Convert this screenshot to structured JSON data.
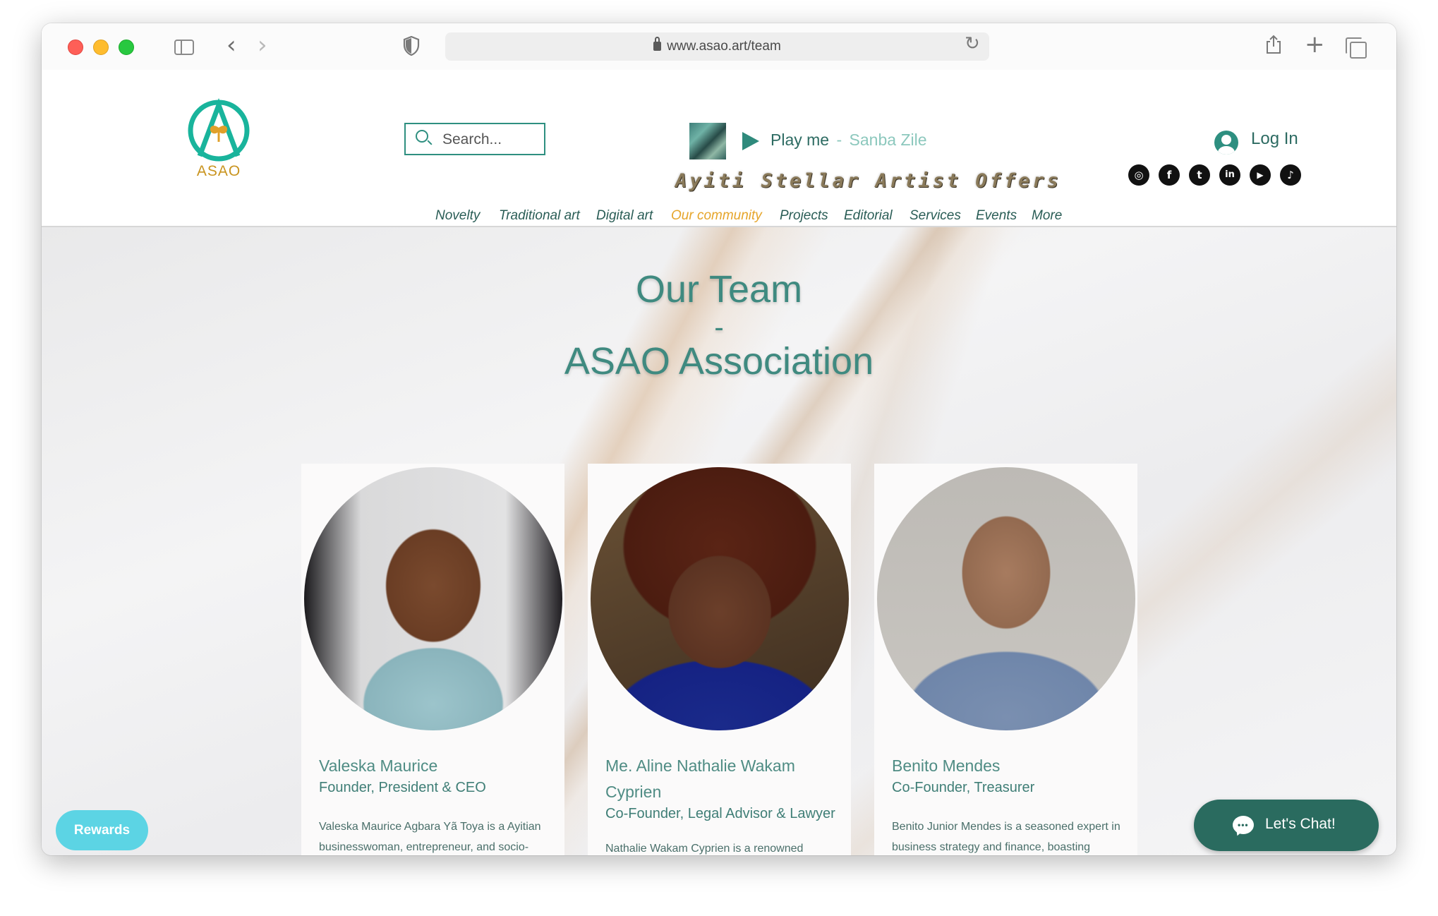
{
  "browser": {
    "url": "www.asao.art/team"
  },
  "header": {
    "logo_text": "ASAO",
    "search_placeholder": "Search...",
    "player": {
      "label": "Play me",
      "separator": "-",
      "song": "Sanba Zile"
    },
    "tagline": "Ayiti Stellar Artist Offers",
    "login_label": "Log In",
    "social_icons": [
      "instagram-icon",
      "facebook-icon",
      "twitter-icon",
      "linkedin-icon",
      "youtube-icon",
      "tiktok-icon"
    ]
  },
  "nav": {
    "items": [
      "Novelty",
      "Traditional art",
      "Digital art",
      "Our community",
      "Projects",
      "Editorial",
      "Services",
      "Events",
      "More"
    ],
    "active": "Our community"
  },
  "page": {
    "title_line1": "Our Team",
    "title_line2": "-",
    "title_line3": "ASAO Association"
  },
  "team": [
    {
      "name": "Valeska Maurice",
      "role": "Founder, President & CEO",
      "bio": "Valeska Maurice Agbara Yã Toya is a Ayitian businesswoman, entrepreneur, and socio-political activist committed"
    },
    {
      "name": "Me. Aline Nathalie Wakam Cyprien",
      "role": "Co-Founder, Legal Advisor & Lawyer",
      "bio": "Nathalie Wakam Cyprien is a renowned lawyer specializing in business law"
    },
    {
      "name": "Benito Mendes",
      "role": "Co-Founder, Treasurer",
      "bio": "Benito Junior Mendes is a seasoned expert in business strategy and finance, boasting extensive experience"
    }
  ],
  "widgets": {
    "rewards_label": "Rewards",
    "chat_label": "Let's Chat!"
  },
  "colors": {
    "brand_teal": "#2e8f80",
    "nav_active": "#e6a52a",
    "chat_bg": "#2a6b5f",
    "rewards_bg": "#5cd4e4"
  }
}
